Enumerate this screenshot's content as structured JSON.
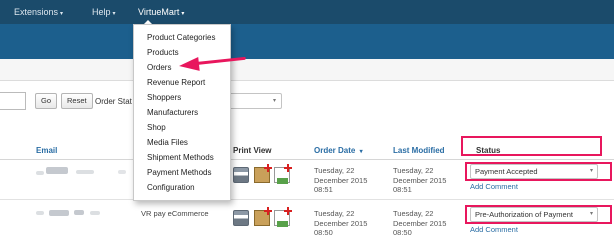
{
  "topnav": {
    "extensions": "Extensions",
    "help": "Help",
    "virtuemart": "VirtueMart"
  },
  "virtuemart_menu": {
    "items": [
      "Product Categories",
      "Products",
      "Orders",
      "Revenue Report",
      "Shoppers",
      "Manufacturers",
      "Shop",
      "Media Files",
      "Shipment Methods",
      "Payment Methods",
      "Configuration"
    ]
  },
  "filters": {
    "go_label": "Go",
    "reset_label": "Reset",
    "order_status_label": "Order Stat"
  },
  "table": {
    "headers": {
      "email": "Email",
      "print_view": "Print View",
      "order_date": "Order Date",
      "last_modified": "Last Modified",
      "status": "Status"
    },
    "rows": [
      {
        "name": "",
        "order_date": [
          "Tuesday, 22",
          "December 2015",
          "08:51"
        ],
        "last_modified": [
          "Tuesday, 22",
          "December 2015",
          "08:51"
        ],
        "status": "Payment Accepted",
        "add_comment": "Add Comment"
      },
      {
        "name": "VR pay eCommerce",
        "order_date": [
          "Tuesday, 22",
          "December 2015",
          "08:50"
        ],
        "last_modified": [
          "Tuesday, 22",
          "December 2015",
          "08:50"
        ],
        "status": "Pre-Authorization of Payment",
        "add_comment": "Add Comment"
      }
    ]
  },
  "colors": {
    "topbar": "#1b4b6b",
    "bluebar": "#1c5f8d",
    "highlight": "#e8175d",
    "link": "#2a6da4"
  },
  "icons": {
    "caret": "▾",
    "sort": "▾"
  }
}
